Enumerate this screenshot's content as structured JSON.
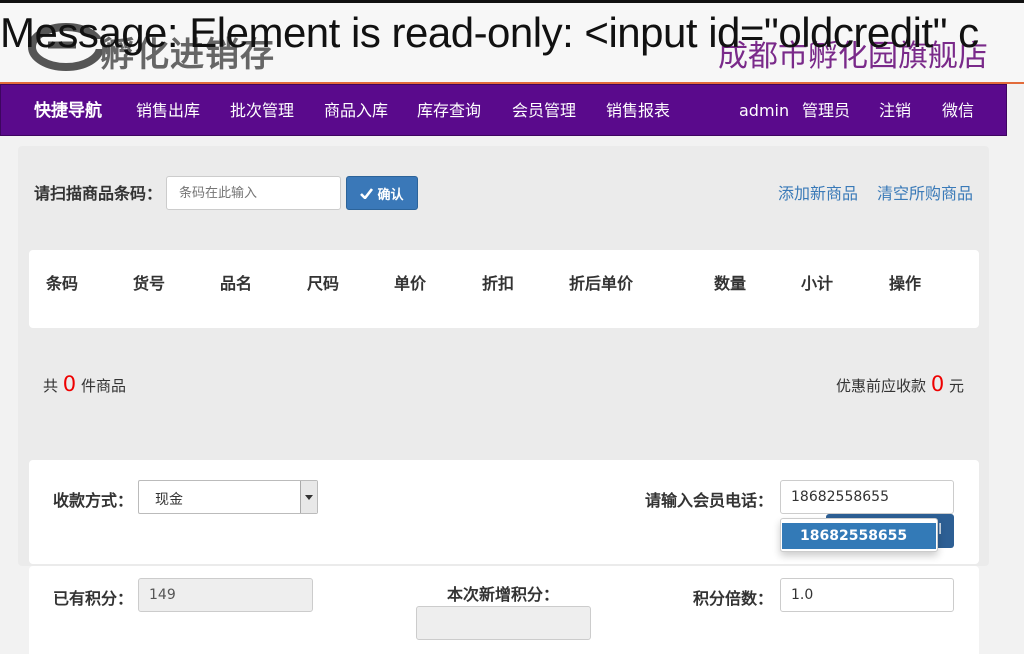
{
  "header": {
    "logo_text": "孵化进销存",
    "error_message": "Message: Element is read-only: <input id=\"oldcredit\" c",
    "store_name": "成都市孵化园旗舰店"
  },
  "nav": {
    "brand": "快捷导航",
    "items": [
      "销售出库",
      "批次管理",
      "商品入库",
      "库存查询",
      "会员管理",
      "销售报表"
    ],
    "user": "admin",
    "role": "管理员",
    "logout": "注销",
    "wechat": "微信"
  },
  "scan": {
    "label": "请扫描商品条码：",
    "placeholder": "条码在此输入",
    "confirm_label": "确认",
    "add_new_link": "添加新商品",
    "clear_link": "清空所购商品"
  },
  "table": {
    "columns": [
      "条码",
      "货号",
      "品名",
      "尺码",
      "单价",
      "折扣",
      "折后单价",
      "数量",
      "小计",
      "操作"
    ]
  },
  "summary": {
    "count_prefix": "共",
    "count": "0",
    "count_suffix": "件商品",
    "amount_prefix": "优惠前应收款",
    "amount": "0",
    "amount_suffix": "元"
  },
  "payment": {
    "method_label": "收款方式：",
    "method_value": "现金",
    "phone_label": "请输入会员电话：",
    "phone_value": "18682558655",
    "suggestion": "18682558655",
    "hidden_button_label": "l"
  },
  "points": {
    "existing_label": "已有积分：",
    "existing_value": "149",
    "new_label": "本次新增积分：",
    "new_value": "",
    "multiplier_label": "积分倍数：",
    "multiplier_value": "1.0"
  },
  "colors": {
    "nav_bg": "#5a0a8c",
    "accent_blue": "#3a78b8",
    "link_blue": "#3a7ab8",
    "store_purple": "#7a2a8a",
    "red": "#e00000"
  }
}
